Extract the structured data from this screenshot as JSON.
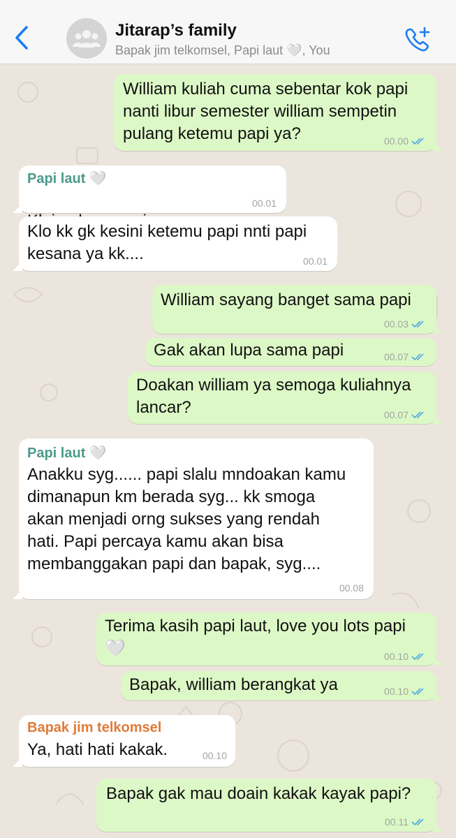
{
  "header": {
    "title": "Jitarap’s family",
    "subtitle": "Bapak jim telkomsel, Papi laut 🤍, You",
    "accent_color": "#1a7cf5",
    "back_icon": "chevron-left-icon",
    "avatar_icon": "group-avatar-icon",
    "call_icon": "add-call-icon"
  },
  "colors": {
    "outgoing_bubble": "#dcf8c6",
    "incoming_bubble": "#ffffff",
    "papi_name": "#4a9a8a",
    "bapak_name": "#e07b39",
    "read_ticks": "#4fa8e8"
  },
  "messages": [
    {
      "dir": "out",
      "text": "William kuliah cuma sebentar kok papi\nnanti libur semester william sempetin\npulang ketemu papi ya?",
      "time": "00.00",
      "read": true
    },
    {
      "dir": "in",
      "sender": "Papi laut 🤍",
      "text": "Kk jgn lupa papi ya....",
      "emoji": "😓",
      "time": "00.01"
    },
    {
      "dir": "in",
      "text": "Klo kk gk kesini ketemu papi nnti papi\nkesana ya kk....",
      "time": "00.01"
    },
    {
      "dir": "out",
      "text": "William sayang banget sama papi",
      "time": "00.03",
      "read": true
    },
    {
      "dir": "out",
      "text": "Gak akan lupa sama papi",
      "time": "00.07",
      "read": true
    },
    {
      "dir": "out",
      "text": "Doakan william ya semoga kuliahnya\nlancar?",
      "time": "00.07",
      "read": true
    },
    {
      "dir": "in",
      "sender": "Papi laut 🤍",
      "text": "Anakku syg...... papi slalu mndoakan kamu\ndimanapun km berada syg... kk smoga\nakan  menjadi orng sukses yang rendah\nhati. Papi percaya kamu akan bisa\nmembanggakan papi dan bapak, syg....",
      "time": "00.08"
    },
    {
      "dir": "out",
      "text": "Terima kasih papi laut, love you lots papi\n🤍",
      "time": "00.10",
      "read": true
    },
    {
      "dir": "out",
      "text": "Bapak, william berangkat ya",
      "time": "00.10",
      "read": true
    },
    {
      "dir": "in",
      "sender": "Bapak jim telkomsel",
      "text": "Ya, hati hati kakak.",
      "time": "00.10"
    },
    {
      "dir": "out",
      "text": "Bapak gak mau doain kakak kayak papi?",
      "time": "00.11",
      "read": true
    }
  ]
}
